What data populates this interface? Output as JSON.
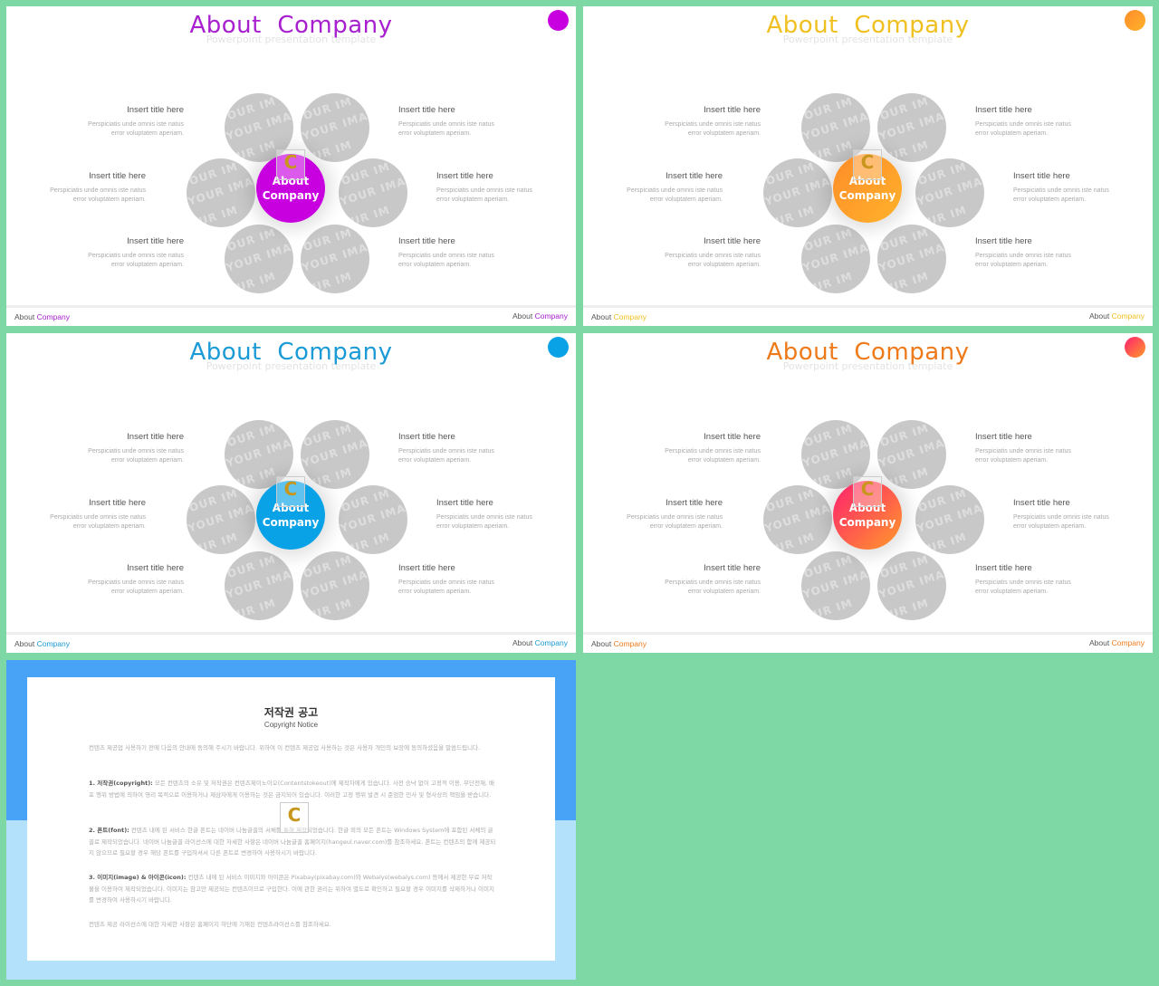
{
  "slides": [
    {
      "title": "About  Company",
      "subtitle": "Powerpoint presentation template",
      "accent": "#c800e0",
      "accent_gradient": [
        "#c800e0",
        "#c800e0"
      ],
      "title_color": "#a81fd0",
      "center_label_1": "About",
      "center_label_2": "Company",
      "footer": {
        "left_1": "About",
        "left_2": "Company",
        "right_1": "About",
        "right_2": "Company"
      }
    },
    {
      "title": "About  Company",
      "subtitle": "Powerpoint presentation template",
      "accent": "#ff9f2a",
      "accent_gradient": [
        "#ff8c2a",
        "#ffb22a"
      ],
      "title_color": "#f0c020",
      "center_label_1": "About",
      "center_label_2": "Company",
      "footer": {
        "left_1": "About",
        "left_2": "Company",
        "right_1": "About",
        "right_2": "Company"
      }
    },
    {
      "title": "About  Company",
      "subtitle": "Powerpoint presentation template",
      "accent": "#0aa2e6",
      "accent_gradient": [
        "#0aa2e6",
        "#0aa2e6"
      ],
      "title_color": "#1a9ad6",
      "center_label_1": "About",
      "center_label_2": "Company",
      "footer": {
        "left_1": "About",
        "left_2": "Company",
        "right_1": "About",
        "right_2": "Company"
      }
    },
    {
      "title": "About  Company",
      "subtitle": "Powerpoint presentation template",
      "accent": "#ff5050",
      "accent_gradient": [
        "#ff1f6f",
        "#ff9a2a"
      ],
      "title_color": "#ee7a1a",
      "center_label_1": "About",
      "center_label_2": "Company",
      "footer": {
        "left_1": "About",
        "left_2": "Company",
        "right_1": "About",
        "right_2": "Company"
      }
    }
  ],
  "items": [
    {
      "title": "Insert title here",
      "desc_1": "Perspiciatis unde omnis iste natus",
      "desc_2": "error voluptatem aperiam."
    },
    {
      "title": "Insert title here",
      "desc_1": "Perspiciatis unde omnis iste natus",
      "desc_2": "error voluptatem aperiam."
    },
    {
      "title": "Insert title here",
      "desc_1": "Perspiciatis unde omnis iste natus",
      "desc_2": "error voluptatem aperiam."
    },
    {
      "title": "Insert title here",
      "desc_1": "Perspiciatis unde omnis iste natus",
      "desc_2": "error voluptatem aperiam."
    },
    {
      "title": "Insert title here",
      "desc_1": "Perspiciatis unde omnis iste natus",
      "desc_2": "error voluptatem aperiam."
    },
    {
      "title": "Insert title here",
      "desc_1": "Perspiciatis unde omnis iste natus",
      "desc_2": "error voluptatem aperiam."
    }
  ],
  "placeholder_watermark": [
    "YOUR IM",
    "E YOUR IMA",
    "YOUR IM"
  ],
  "logo_glyph": "C",
  "copyright": {
    "title": "저작권 공고",
    "subtitle": "Copyright Notice",
    "intro": "컨텐츠 제공업 사용하기 전에 다음의 안내에 동의해 주시기 바랍니다. 위하여 이 컨텐츠 제공업 사용하는 것은 사용자 개인의 보장에 동의하셨음을 말씀드립니다.",
    "p1_head": "1. 저작권(copyright):",
    "p1_body": "모든 컨텐츠의 소유 및 저작권은 컨텐츠제이노이오(Contentstokeout)에 제작자에게 있습니다. 사전 승낙 없이 고정적 이용, 무단전재, 배포 행위 방법에 의하여 영리 목적으로 이용하거나 제삼자에게 이용하는 것은 금지되어 있습니다. 이러한 고정 행위 발견 시 준엄한 민사 및 형사상의 책임을 받습니다.",
    "p2_head": "2. 폰트(font):",
    "p2_body": "컨텐츠 내에 된 서비스 한글 폰트는 네이버 나눔글꼴의 서체를 통해 제작되었습니다. 한글 외의 모든 폰트는 Windows System에 포함된 서체의 글꼴로 제작되었습니다. 네이버 나눔글꼴 라이선스에 대한 자세한 사항은 네이버 나눔글꼴 홈페이지(hangeul.naver.com)를 참조하세요. 폰트는 컨텐츠의 함께 제공되지 않으므로 필요할 경우 해당 폰트를 구입하셔서 다른 폰트로 변경하여 사용하시기 바랍니다.",
    "p3_head": "3. 이미지(image) & 아이콘(icon):",
    "p3_body": "컨텐츠 내에 된 서비스 이미지와 아이콘은 Pixabay(pixabay.com)와 Webalys(webalys.com) 등에서 제공한 무료 저작물을 이용하여 제작되었습니다. 이미지는 참고만 제공되는 컨텐츠이므로 구입한다. 이에 관한 권리는 위하여 별도로 확인하고 필요할 경우 이미지를 삭제하거나 이미지를 변경하여 사용하시기 바랍니다.",
    "closing": "컨텐츠 제공 라이선스에 대한 자세한 사항은 홈페이지 하단에 기재된 컨텐츠라이선스를 참조하세요.",
    "band_color_top": "#48a2f5",
    "band_color_bottom": "#b3e0fb"
  }
}
